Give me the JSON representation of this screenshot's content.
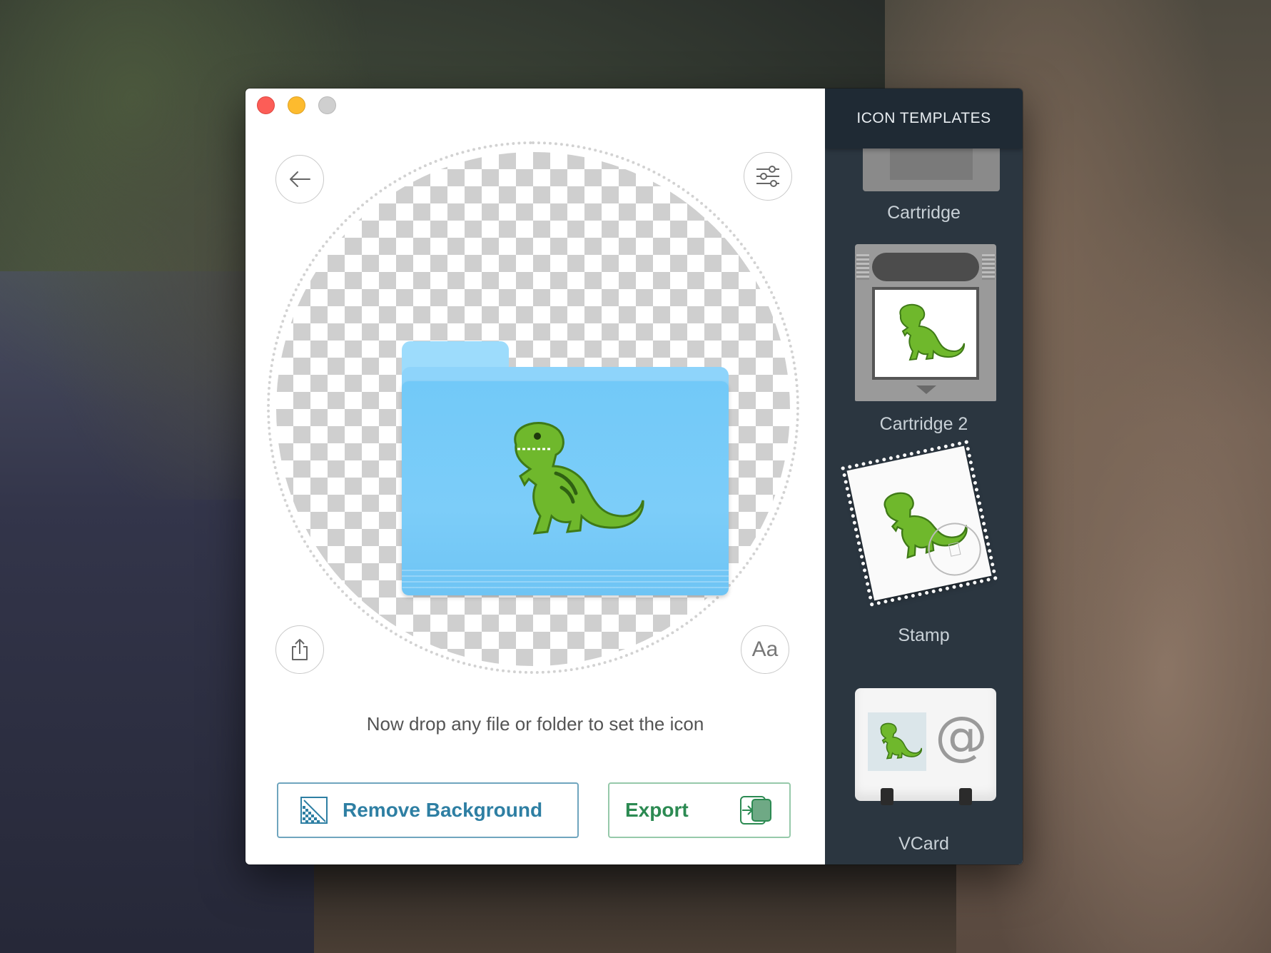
{
  "window": {
    "controls": [
      "close",
      "minimize",
      "zoom"
    ]
  },
  "main": {
    "instruction": "Now drop any file or folder to set the icon",
    "text_button_label": "Aa",
    "remove_background_label": "Remove Background",
    "export_label": "Export",
    "icons": {
      "back": "arrow-left-icon",
      "settings": "sliders-icon",
      "share": "share-icon",
      "remove_bg": "checkerboard-icon",
      "export": "export-icon",
      "preview": "folder-icon",
      "dinosaur": "t-rex-emoji"
    }
  },
  "sidebar": {
    "title": "ICON TEMPLATES",
    "templates": [
      {
        "label": "Cartridge"
      },
      {
        "label": "Cartridge 2"
      },
      {
        "label": "Stamp"
      },
      {
        "label": "VCard"
      }
    ]
  },
  "colors": {
    "sidebar_bg": "#2b3640",
    "sidebar_header_bg": "#1f2a34",
    "remove_button_accent": "#2e7fa3",
    "export_button_accent": "#2c8a52",
    "folder_blue": "#72c9f8"
  }
}
